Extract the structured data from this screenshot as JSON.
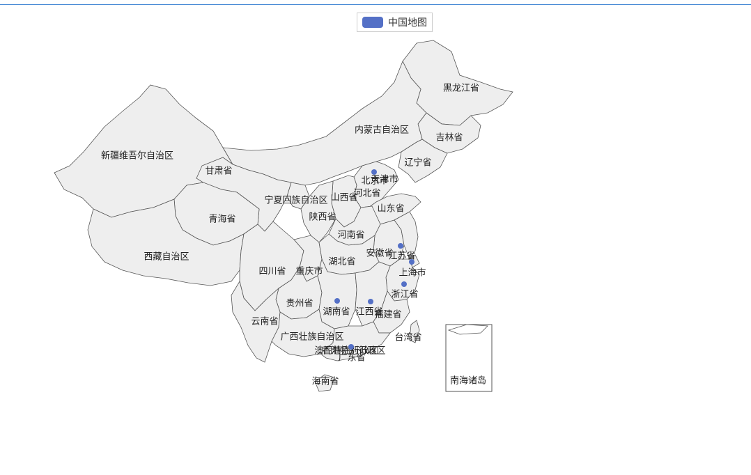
{
  "legend": {
    "label": "中国地图",
    "color": "#5470c6"
  },
  "colors": {
    "province_fill": "#eeeeee",
    "province_stroke": "#555555",
    "dot": "#5470c6",
    "top_line": "#4a8cd6"
  },
  "provinces": [
    {
      "id": "heilongjiang",
      "label": "黑龙江省"
    },
    {
      "id": "jilin",
      "label": "吉林省"
    },
    {
      "id": "liaoning",
      "label": "辽宁省"
    },
    {
      "id": "neimenggu",
      "label": "内蒙古自治区"
    },
    {
      "id": "xinjiang",
      "label": "新疆维吾尔自治区"
    },
    {
      "id": "gansu",
      "label": "甘肃省"
    },
    {
      "id": "beijing",
      "label": "北京市"
    },
    {
      "id": "tianjin",
      "label": "天津市"
    },
    {
      "id": "hebei",
      "label": "河北省"
    },
    {
      "id": "shanxi",
      "label": "山西省"
    },
    {
      "id": "ningxia",
      "label": "宁夏回族自治区"
    },
    {
      "id": "shandong",
      "label": "山东省"
    },
    {
      "id": "qinghai",
      "label": "青海省"
    },
    {
      "id": "shaanxi",
      "label": "陕西省"
    },
    {
      "id": "henan",
      "label": "河南省"
    },
    {
      "id": "xizang",
      "label": "西藏自治区"
    },
    {
      "id": "anhui",
      "label": "安徽省"
    },
    {
      "id": "jiangsu",
      "label": "江苏省"
    },
    {
      "id": "sichuan",
      "label": "四川省"
    },
    {
      "id": "chongqing",
      "label": "重庆市"
    },
    {
      "id": "hubei",
      "label": "湖北省"
    },
    {
      "id": "shanghai",
      "label": "上海市"
    },
    {
      "id": "zhejiang",
      "label": "浙江省"
    },
    {
      "id": "guizhou",
      "label": "贵州省"
    },
    {
      "id": "hunan",
      "label": "湖南省"
    },
    {
      "id": "jiangxi",
      "label": "江西省"
    },
    {
      "id": "fujian",
      "label": "福建省"
    },
    {
      "id": "yunnan",
      "label": "云南省"
    },
    {
      "id": "guangxi",
      "label": "广西壮族自治区"
    },
    {
      "id": "taiwan",
      "label": "台湾省"
    },
    {
      "id": "guangdong",
      "label": "广东省"
    },
    {
      "id": "xianggang",
      "label": "香港特别行政区"
    },
    {
      "id": "aomen",
      "label": "澳门特别行政区"
    },
    {
      "id": "hainan",
      "label": "海南省"
    },
    {
      "id": "nanhai",
      "label": "南海诸岛"
    }
  ],
  "dots": [
    "beijing",
    "jiangsu",
    "shanghai",
    "zhejiang",
    "hunan",
    "jiangxi",
    "guangdong"
  ]
}
